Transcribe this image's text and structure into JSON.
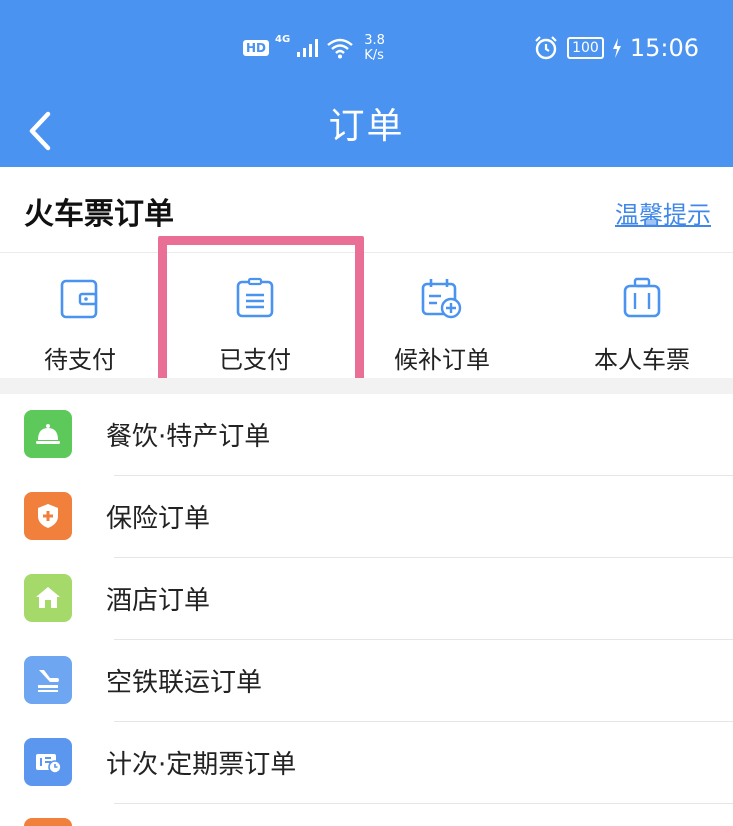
{
  "status_bar": {
    "hd": "HD",
    "network_gen": "4G",
    "speed_value": "3.8",
    "speed_unit": "K/s",
    "battery": "100",
    "time": "15:06"
  },
  "nav": {
    "back_icon": "chevron-left-icon",
    "title": "订单"
  },
  "section": {
    "title": "火车票订单",
    "tips_link": "温馨提示"
  },
  "quick_actions": [
    {
      "label": "待支付",
      "icon": "wallet-icon"
    },
    {
      "label": "已支付",
      "icon": "clipboard-icon"
    },
    {
      "label": "候补订单",
      "icon": "calendar-add-icon"
    },
    {
      "label": "本人车票",
      "icon": "luggage-icon"
    }
  ],
  "order_list": [
    {
      "label": "餐饮·特产订单",
      "icon": "service-bell-icon",
      "color": "#5cc95a"
    },
    {
      "label": "保险订单",
      "icon": "shield-plus-icon",
      "color": "#f0803c"
    },
    {
      "label": "酒店订单",
      "icon": "house-icon",
      "color": "#a5d96a"
    },
    {
      "label": "空铁联运订单",
      "icon": "plane-train-icon",
      "color": "#6fa6f2"
    },
    {
      "label": "计次·定期票订单",
      "icon": "ticket-clock-icon",
      "color": "#5b96ef"
    }
  ],
  "colors": {
    "primary": "#4a93f0",
    "highlight": "#ea6f97",
    "link": "#3f87e8"
  }
}
